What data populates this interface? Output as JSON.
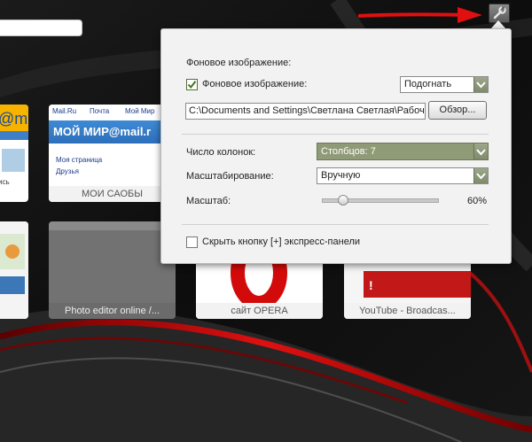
{
  "topbar": {
    "address_value": ""
  },
  "tiles": [
    {
      "caption": "",
      "kind": "mail-partial-left"
    },
    {
      "caption": "МОИ САОБЫ",
      "kind": "mail",
      "preview": {
        "nav": [
          "Mail.Ru",
          "Почта",
          "Мой Мир"
        ],
        "banner": "МОЙ МИР@mail.r",
        "links": [
          "Моя страница",
          "Друзья"
        ]
      }
    },
    {
      "caption": "",
      "kind": "partial-left-2"
    },
    {
      "caption": "Photo editor online /...",
      "kind": "gray"
    },
    {
      "caption": "сайт OPERA",
      "kind": "opera"
    },
    {
      "caption": "YouTube - Broadcas...",
      "kind": "youtube"
    }
  ],
  "panel": {
    "section_title": "Фоновое изображение:",
    "bg_checkbox_label": "Фоновое изображение:",
    "bg_checked": true,
    "fit_select_value": "Подогнать",
    "path_value": "C:\\Documents and Settings\\Светлана Светлая\\Рабочий с",
    "browse_label": "Обзор...",
    "columns_label": "Число колонок:",
    "columns_value": "Столбцов: 7",
    "scaling_label": "Масштабирование:",
    "scaling_value": "Вручную",
    "zoom_label": "Масштаб:",
    "zoom_value_text": "60%",
    "zoom_fraction": 0.18,
    "hide_button_label": "Скрыть кнопку [+] экспресс-панели",
    "hide_checked": false
  },
  "colors": {
    "accent_red": "#e01010",
    "panel_bg": "#f2f2f2",
    "select_green": "#8f9a77"
  }
}
